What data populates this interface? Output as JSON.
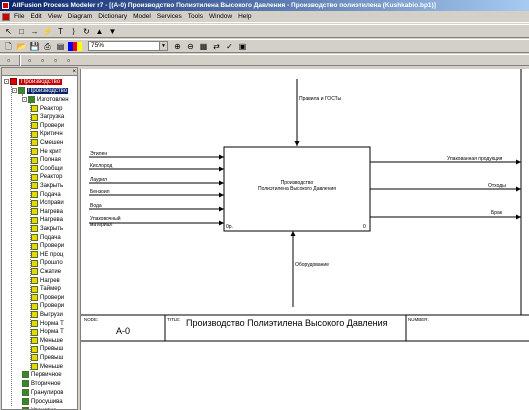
{
  "window": {
    "title": "AllFusion Process Modeler r7 - [(A-0) Производство  Полиэтилена Высокого Давления - Производство полиэтилена  (Kushkabio.bp1)]"
  },
  "menu": [
    "File",
    "Edit",
    "View",
    "Diagram",
    "Dictionary",
    "Model",
    "Services",
    "Tools",
    "Window",
    "Help"
  ],
  "toolbar": {
    "zoom": "75%"
  },
  "tree": {
    "header_close": "×",
    "root": "Производство",
    "level1": "Производство",
    "level2": "Изготовлен",
    "children": [
      "Реактор",
      "Загрузка",
      "Провери",
      "Критичн",
      "Смешен",
      "Не крит",
      "Полная",
      "Сообщи",
      "Реактор",
      "Закрыть",
      "Подача",
      "Исправи",
      "Нагрева",
      "Нагрева",
      "Закрыть",
      "Подача",
      "Провери",
      "НЕ проц",
      "Прошло",
      "Сжатие",
      "Нагрев",
      "Таймер",
      "Провери",
      "Провери",
      "Выгрузи",
      "Норма Т",
      "Норма Т",
      "Меньше",
      "Превыш",
      "Превыш",
      "Меньше"
    ],
    "bottom": [
      "Первичное",
      "Вторичное",
      "Гранулиров",
      "Просушива",
      "Упаковка"
    ]
  },
  "diagram": {
    "control": "Правила и ГОСТы",
    "mechanism": "Оборудование",
    "inputs": [
      "Этилен",
      "Кислород",
      "Лаурил",
      "Бензоил",
      "Вода",
      "Упаковочный материал"
    ],
    "outputs": [
      "Упакованная продукция",
      "Отходы",
      "Брак"
    ],
    "box_title_1": "Производство",
    "box_title_2": "Полиэтилена Высокого Давления",
    "box_cost": "0р.",
    "box_number": "0",
    "form": {
      "node_label": "NODE:",
      "node": "A-0",
      "title_label": "TITLE:",
      "title": "Производство  Полиэтилена Высокого Давления",
      "number_label": "NUMBER:"
    }
  },
  "colors": {
    "titlebar": "#0a246a",
    "root_highlight": "#c00000",
    "leaf_icon": "#e6d900",
    "branch_icon": "#2e8b2e"
  }
}
